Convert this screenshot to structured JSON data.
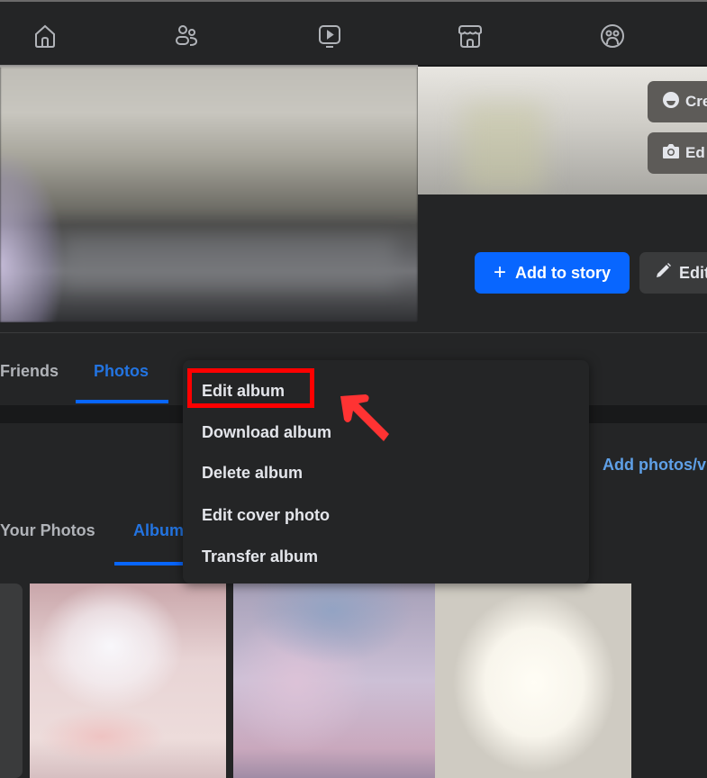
{
  "topnav": {
    "icons": [
      {
        "name": "home-icon",
        "label": "Home"
      },
      {
        "name": "friends-icon",
        "label": "Friends"
      },
      {
        "name": "watch-icon",
        "label": "Watch"
      },
      {
        "name": "marketplace-icon",
        "label": "Marketplace"
      },
      {
        "name": "groups-icon",
        "label": "Groups"
      }
    ]
  },
  "cover": {
    "create_button": "Cre",
    "edit_cover_button": "Ed"
  },
  "profile_actions": {
    "add_to_story": "Add to story",
    "add_to_story_icon": "+",
    "edit_profile": "Edit"
  },
  "profile_tabs": {
    "friends": "Friends",
    "photos": "Photos",
    "active": "Photos"
  },
  "photos_section": {
    "add_photos_link": "Add photos/v",
    "subtabs": {
      "your_photos": "Your Photos",
      "albums": "Album",
      "active": "Albums"
    }
  },
  "context_menu": {
    "items": [
      {
        "label": "Edit album",
        "highlighted": true
      },
      {
        "label": "Download album"
      },
      {
        "label": "Delete album"
      },
      {
        "label": "Edit cover photo"
      },
      {
        "label": "Transfer album"
      }
    ]
  },
  "annotation": {
    "highlight_color": "#ff0000",
    "arrow_color": "#ff3333"
  },
  "colors": {
    "accent": "#0866ff",
    "link": "#2374e1",
    "surface": "#242526",
    "background": "#18191a"
  }
}
